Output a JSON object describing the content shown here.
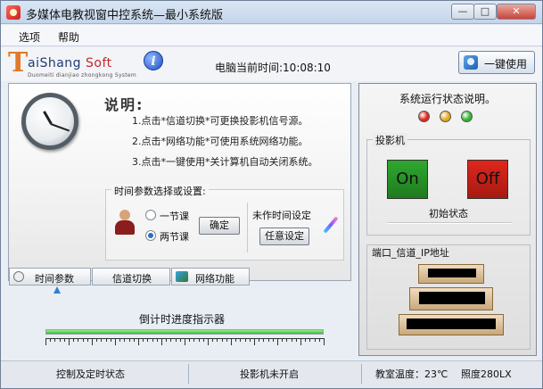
{
  "window": {
    "title": "多媒体电教视窗中控系统—最小系统版",
    "min_label": "—",
    "max_label": "□",
    "close_label": "✕"
  },
  "menu": {
    "items": [
      {
        "label": "选项"
      },
      {
        "label": "帮助"
      }
    ]
  },
  "header": {
    "logo_t": "T",
    "logo_brand": "aiShang ",
    "logo_soft": "Soft",
    "logo_sub": "Duomeiti dianjiao zhongkong System",
    "info_icon": "info-icon",
    "clock_prefix": "电脑当前时间:",
    "clock_time": "10:08:10",
    "onekey_label": "一键使用"
  },
  "explain": {
    "title": "说明:",
    "lines": [
      "1.点击*信道切换*可更换投影机信号源。",
      "2.点击*网络功能*可使用系统网络功能。",
      "3.点击*一键使用*关计算机自动关闭系统。"
    ]
  },
  "params": {
    "title": "时间参数选择或设置:",
    "option_one": "一节课",
    "option_two": "两节课",
    "selected": "两节课",
    "confirm": "确定",
    "unset_label": "未作时间设定",
    "custom_btn": "任意设定"
  },
  "tabs": [
    {
      "label": "时间参数",
      "icon": "clock-radio-icon"
    },
    {
      "label": "信道切换",
      "icon": ""
    },
    {
      "label": "网络功能",
      "icon": "network-icon"
    }
  ],
  "progress": {
    "label": "倒计时进度指示器",
    "fraction": 1.0
  },
  "right": {
    "status_title": "系统运行状态说明。",
    "lights": [
      "#e0261c",
      "#e0a81c",
      "#2fb52f"
    ],
    "projector_title": "投影机",
    "on_label": "On",
    "off_label": "Off",
    "on_color": "#2fa82f",
    "off_color": "#e0261c",
    "init_state": "初始状态",
    "port_label": "端口_信道_IP地址"
  },
  "statusbar": {
    "control": "控制及定时状态",
    "projector": "投影机未开启",
    "temp": "教室温度：23℃",
    "light": "照度280LX"
  }
}
